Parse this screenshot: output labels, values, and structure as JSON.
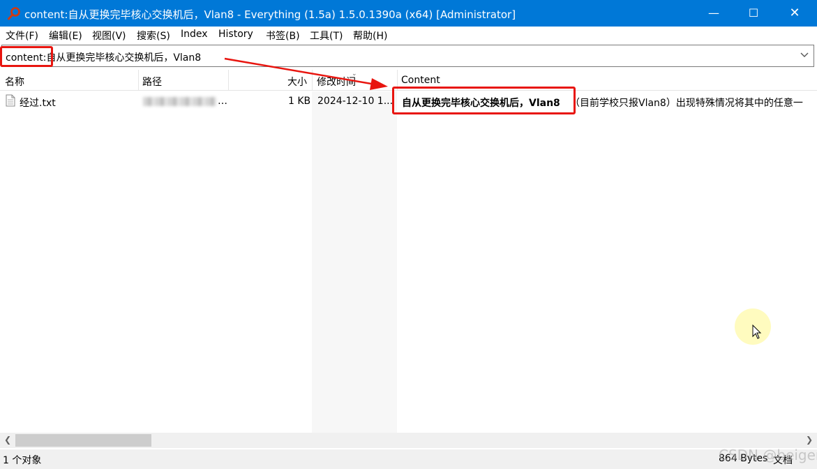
{
  "window": {
    "title": "content:自从更换完毕核心交换机后，Vlan8 - Everything (1.5a) 1.5.0.1390a (x64) [Administrator]",
    "minimize_glyph": "—",
    "maximize_glyph": "☐",
    "close_glyph": "✕"
  },
  "menu": [
    "文件(F)",
    "编辑(E)",
    "视图(V)",
    "搜索(S)",
    "Index",
    "History",
    "书签(B)",
    "工具(T)",
    "帮助(H)"
  ],
  "search": {
    "value": "content:自从更换完毕核心交换机后，Vlan8"
  },
  "columns": {
    "name": "名称",
    "path": "路径",
    "size": "大小",
    "modified": "修改时间",
    "content": "Content"
  },
  "results": [
    {
      "name": "经过.txt",
      "size": "1 KB",
      "modified": "2024-12-10 1...",
      "content_match": "自从更换完毕核心交换机后，Vlan8",
      "content_rest": "（目前学校只报Vlan8）出现特殊情况将其中的任意一"
    }
  ],
  "status": {
    "count": "1 个对象",
    "size": "864 Bytes",
    "mode": "文档"
  },
  "watermark": "CSDN @beiger",
  "icons": {
    "app": "magnifier-icon",
    "file": "text-file-icon",
    "dropdown": "chevron-down-icon",
    "scroll_left": "scroll-left-icon",
    "scroll_right": "scroll-right-icon"
  },
  "colors": {
    "titlebar": "#0078d7",
    "annotation": "#e8150f",
    "app_icon": "#d4380d"
  }
}
